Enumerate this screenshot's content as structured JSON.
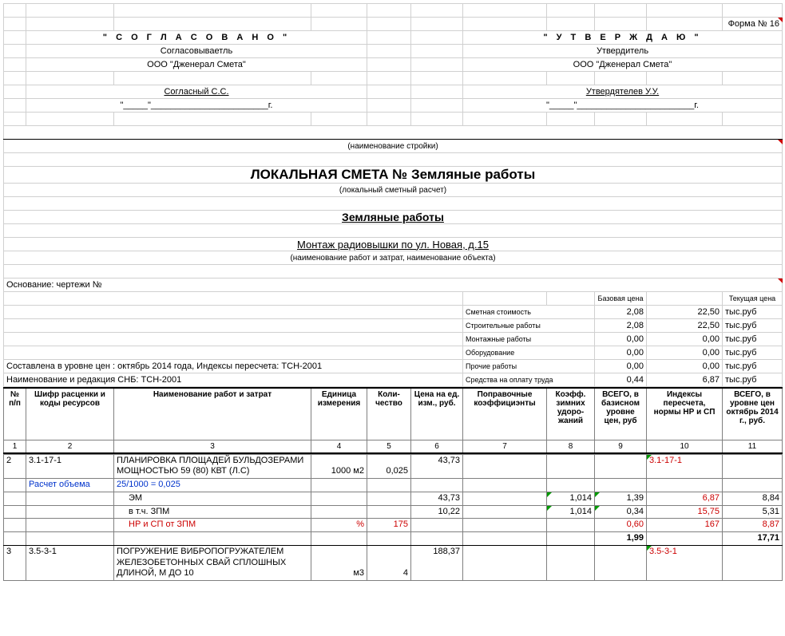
{
  "form_no": "Форма № 16",
  "left_block": {
    "title": "\" С О Г Л А С О В А Н О \"",
    "role": "Согласовываетль",
    "org": "ООО \"Дженерал Смета\"",
    "name": "Согласный С.С.",
    "date": "\"_____\"________________________г."
  },
  "right_block": {
    "title": "\" У Т В Е Р Ж Д А Ю \"",
    "role": "Утвердитель",
    "org": "ООО \"Дженерал Смета\"",
    "name": "Утвердятелев У.У.",
    "date": "\"_____\"________________________г."
  },
  "constr_name_label": "(наименование стройки)",
  "main_title": "ЛОКАЛЬНАЯ СМЕТА № Земляные работы",
  "main_sub": "(локальный сметный расчет)",
  "work_title": "Земляные работы",
  "object": "Монтаж радиовышки по ул. Новая, д.15",
  "object_label": "(наименование работ и затрат, наименование объекта)",
  "basis": "Основание: чертежи №",
  "price_headers": {
    "base": "Базовая цена",
    "cur": "Текущая цена"
  },
  "summary_rows": [
    {
      "label": "Сметная стоимость",
      "base": "2,08",
      "cur": "22,50",
      "unit": "тыс.руб"
    },
    {
      "label": "Строительные работы",
      "base": "2,08",
      "cur": "22,50",
      "unit": "тыс.руб"
    },
    {
      "label": "Монтажные работы",
      "base": "0,00",
      "cur": "0,00",
      "unit": "тыс.руб"
    },
    {
      "label": "Оборудование",
      "base": "0,00",
      "cur": "0,00",
      "unit": "тыс.руб"
    },
    {
      "label": "Прочие работы",
      "base": "0,00",
      "cur": "0,00",
      "unit": "тыс.руб"
    },
    {
      "label": "Средства на оплату труда",
      "base": "0,44",
      "cur": "6,87",
      "unit": "тыс.руб"
    }
  ],
  "compiled": "Составлена в уровне цен : октябрь 2014 года, Индексы пересчета: ТСН-2001",
  "snb": "Наименование и редакция СНБ: ТСН-2001",
  "thead": {
    "c1": "№ п/п",
    "c2": "Шифр расценки и коды ресурсов",
    "c3": "Наименование работ и затрат",
    "c4": "Единица измерения",
    "c5": "Коли-чество",
    "c6": "Цена на ед. изм., руб.",
    "c7": "Поправочные коэффициэнты",
    "c8": "Коэфф. зимних удоро-жаний",
    "c9": "ВСЕГО, в базисном уровне цен, руб",
    "c10": "Индексы пересчета, нормы НР и СП",
    "c11": "ВСЕГО, в уровне цен октябрь 2014 г., руб."
  },
  "nums": [
    "1",
    "2",
    "3",
    "4",
    "5",
    "6",
    "7",
    "8",
    "9",
    "10",
    "11"
  ],
  "row2": {
    "n": "2",
    "code": "3.1-17-1",
    "name": "ПЛАНИРОВКА ПЛОЩАДЕЙ БУЛЬДОЗЕРАМИ МОЩНОСТЬЮ 59 (80) КВТ (Л.С)",
    "unit": "1000 м2",
    "qty": "0,025",
    "price": "43,73",
    "idx": "3.1-17-1"
  },
  "row2a": {
    "label": "Расчет объема",
    "formula": "25/1000 = 0,025"
  },
  "row2b": {
    "name": "ЭМ",
    "price": "43,73",
    "coef": "1,014",
    "base": "1,39",
    "idx": "6,87",
    "tot": "8,84"
  },
  "row2c": {
    "name": "в т.ч. ЗПМ",
    "price": "10,22",
    "coef": "1,014",
    "base": "0,34",
    "idx": "15,75",
    "tot": "5,31"
  },
  "row2d": {
    "name": "НР и СП от ЗПМ",
    "unit": "%",
    "qty": "175",
    "base": "0,60",
    "idx": "167",
    "tot": "8,87"
  },
  "row2tot": {
    "base": "1,99",
    "tot": "17,71"
  },
  "row3": {
    "n": "3",
    "code": "3.5-3-1",
    "name": "ПОГРУЖЕНИЕ ВИБРОПОГРУЖАТЕЛЕМ ЖЕЛЕЗОБЕТОННЫХ СВАЙ СПЛОШНЫХ ДЛИНОЙ, М ДО 10",
    "unit": "м3",
    "qty": "4",
    "price": "188,37",
    "idx": "3.5-3-1"
  }
}
